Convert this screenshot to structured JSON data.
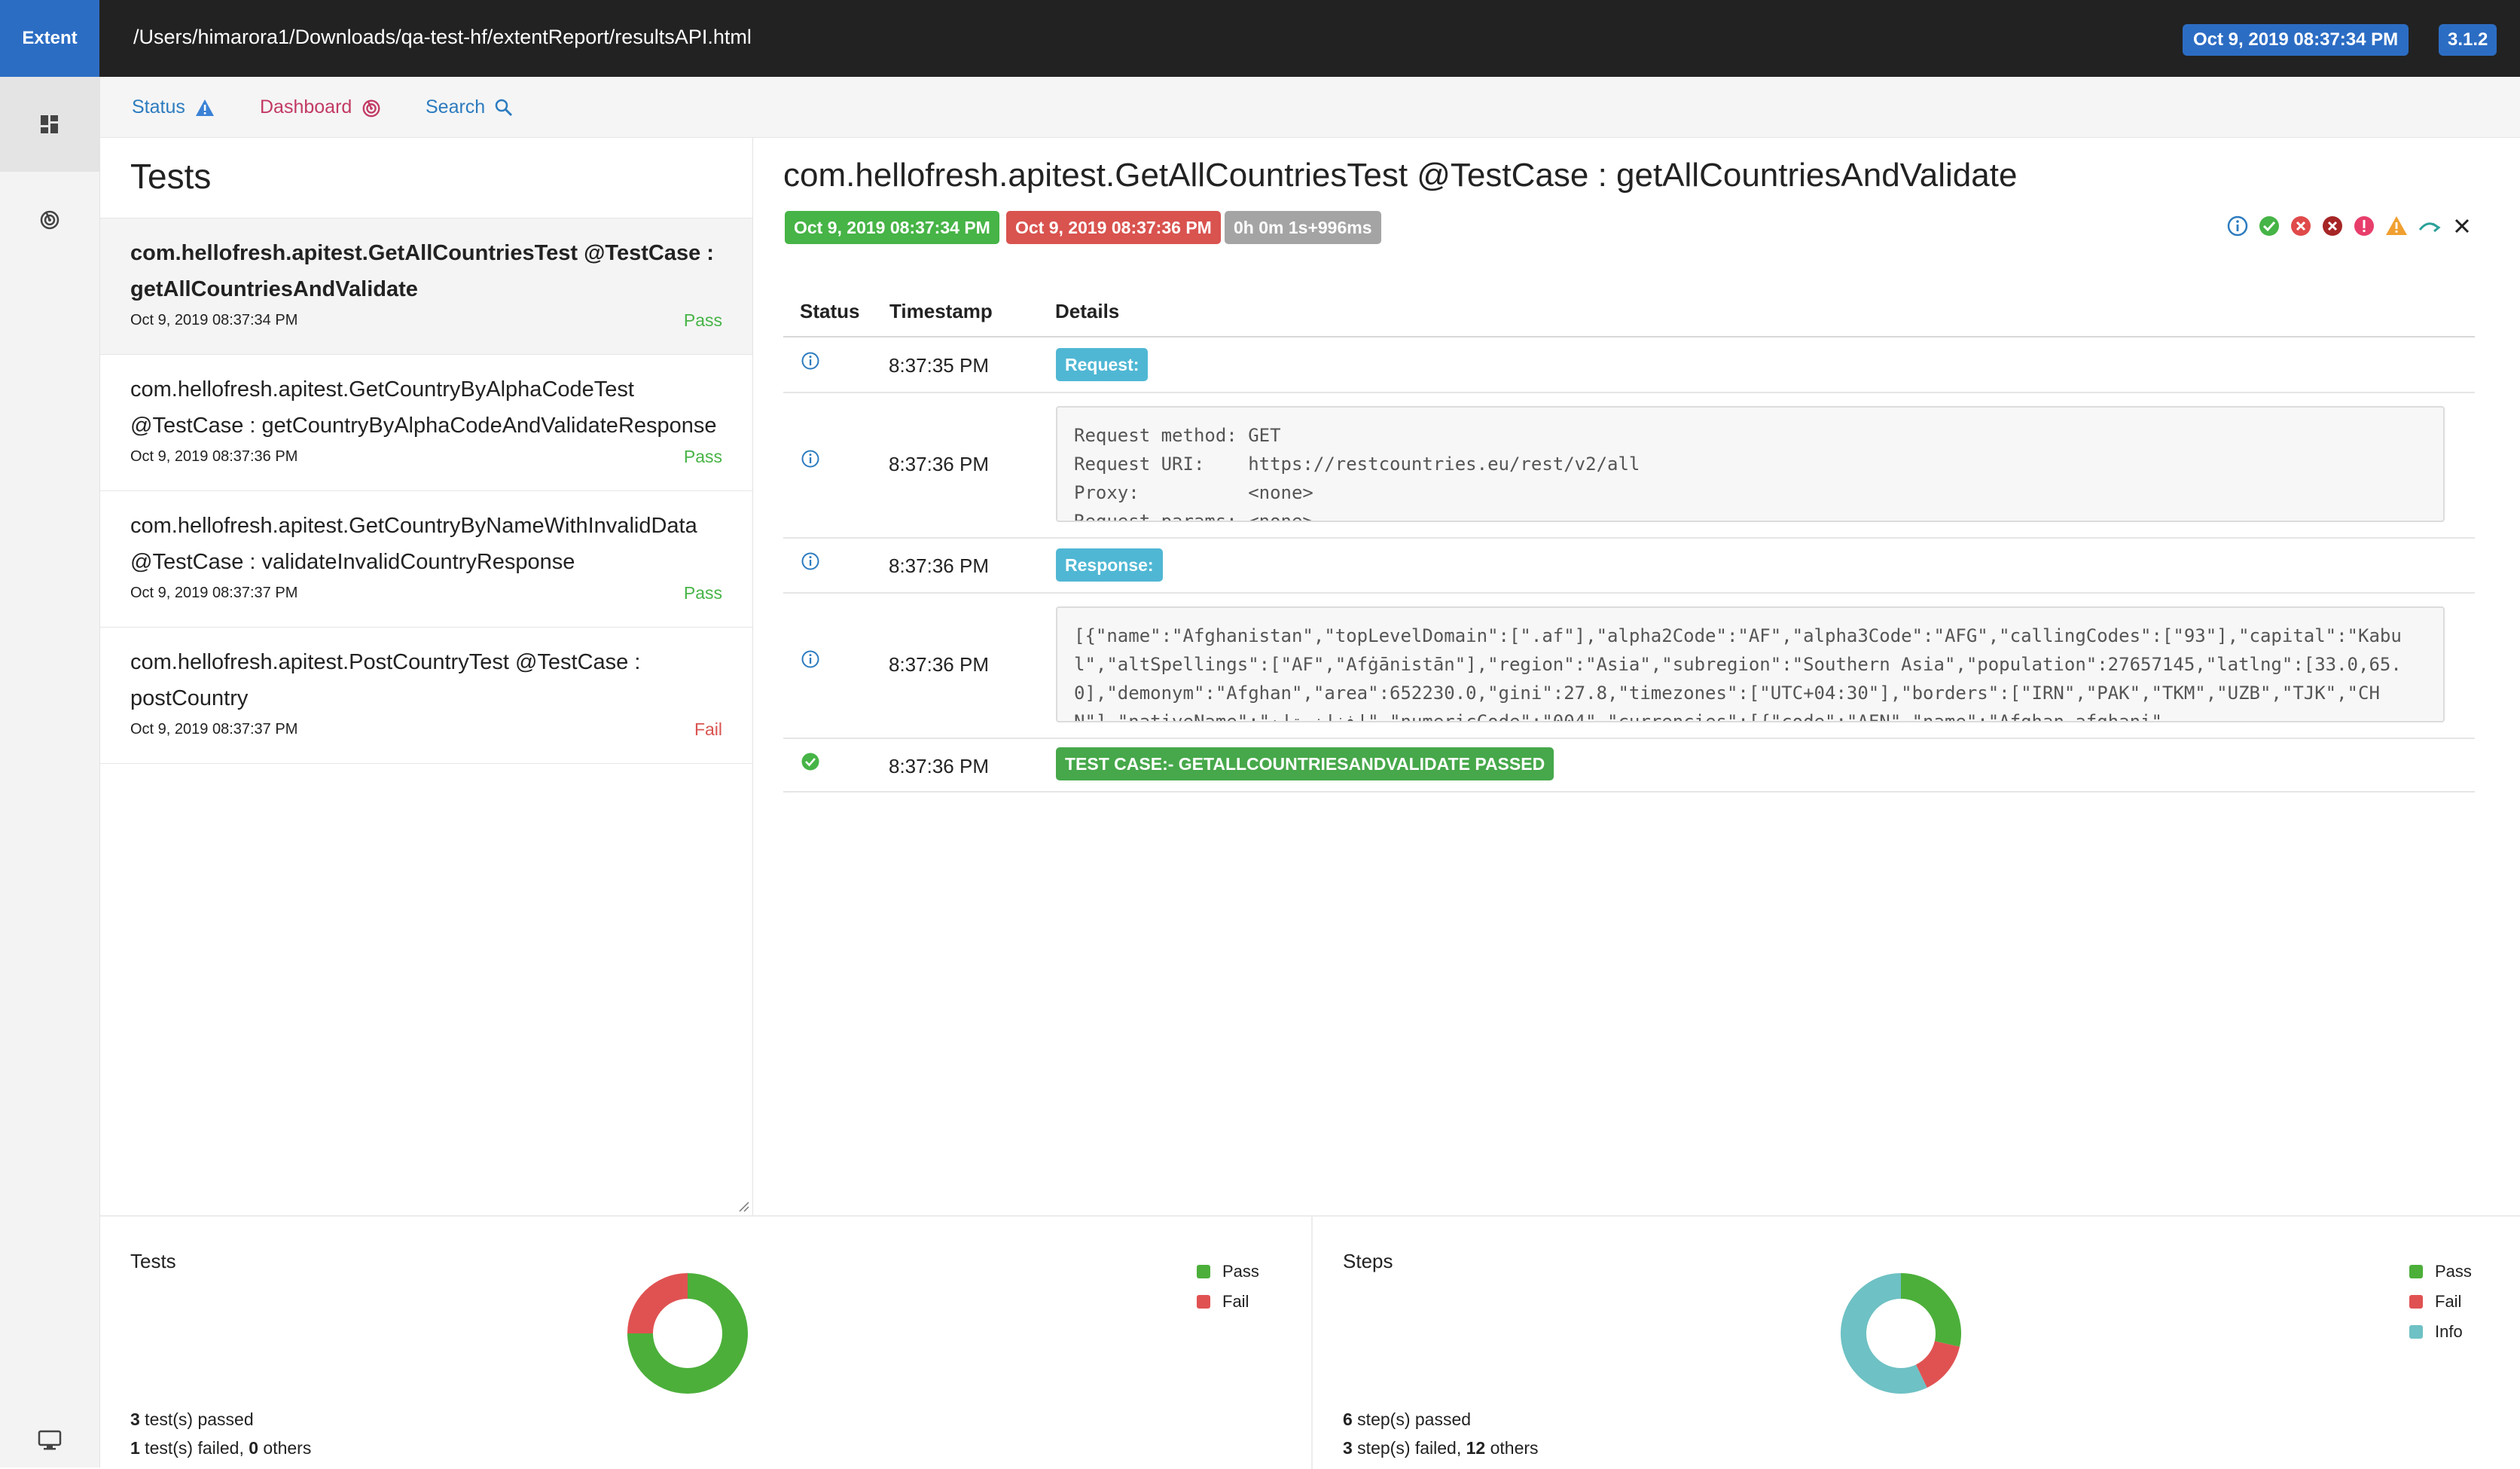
{
  "app": {
    "brand": "Extent",
    "file_path": "/Users/himarora1/Downloads/qa-test-hf/extentReport/resultsAPI.html",
    "report_time": "Oct 9, 2019 08:37:34 PM",
    "version": "3.1.2"
  },
  "sidebar": {
    "items": [
      {
        "icon": "dashboard-grid-icon"
      },
      {
        "icon": "dashboard-radar-icon"
      },
      {
        "icon": "monitor-icon"
      }
    ]
  },
  "subnav": {
    "status_label": "Status",
    "dashboard_label": "Dashboard",
    "search_label": "Search"
  },
  "tests_panel": {
    "title": "Tests",
    "items": [
      {
        "name": "com.hellofresh.apitest.GetAllCountriesTest @TestCase : getAllCountriesAndValidate",
        "time": "Oct 9, 2019 08:37:34 PM",
        "status": "Pass"
      },
      {
        "name": "com.hellofresh.apitest.GetCountryByAlphaCodeTest @TestCase : getCountryByAlphaCodeAndValidateResponse",
        "time": "Oct 9, 2019 08:37:36 PM",
        "status": "Pass"
      },
      {
        "name": "com.hellofresh.apitest.GetCountryByNameWithInvalidData @TestCase : validateInvalidCountryResponse",
        "time": "Oct 9, 2019 08:37:37 PM",
        "status": "Pass"
      },
      {
        "name": "com.hellofresh.apitest.PostCountryTest @TestCase : postCountry",
        "time": "Oct 9, 2019 08:37:37 PM",
        "status": "Fail"
      }
    ]
  },
  "detail": {
    "title": "com.hellofresh.apitest.GetAllCountriesTest @TestCase : getAllCountriesAndValidate",
    "start_time": "Oct 9, 2019 08:37:34 PM",
    "end_time": "Oct 9, 2019 08:37:36 PM",
    "duration": "0h 0m 1s+996ms",
    "columns": {
      "status": "Status",
      "timestamp": "Timestamp",
      "details": "Details"
    },
    "logs": [
      {
        "status_icon": "info-icon",
        "time": "8:37:35 PM",
        "label": "Request:"
      },
      {
        "status_icon": "info-icon",
        "time": "8:37:36 PM",
        "code": "Request method:\tGET\nRequest URI:\thttps://restcountries.eu/rest/v2/all\nProxy:\t\t\t<none>\nRequest params:\t<none>"
      },
      {
        "status_icon": "info-icon",
        "time": "8:37:36 PM",
        "label": "Response:"
      },
      {
        "status_icon": "info-icon",
        "time": "8:37:36 PM",
        "code": "[{\"name\":\"Afghanistan\",\"topLevelDomain\":[\".af\"],\"alpha2Code\":\"AF\",\"alpha3Code\":\"AFG\",\"callingCodes\":[\"93\"],\"capital\":\"Kabul\",\"altSpellings\":[\"AF\",\"Afġānistān\"],\"region\":\"Asia\",\"subregion\":\"Southern Asia\",\"population\":27657145,\"latlng\":[33.0,65.0],\"demonym\":\"Afghan\",\"area\":652230.0,\"gini\":27.8,\"timezones\":[\"UTC+04:30\"],\"borders\":[\"IRN\",\"PAK\",\"TKM\",\"UZB\",\"TJK\",\"CHN\"],\"nativeName\":\"افغانستان\",\"numericCode\":\"004\",\"currencies\":[{\"code\":\"AFN\",\"name\":\"Afghan afghani\""
      },
      {
        "status_icon": "check-circle-icon",
        "time": "8:37:36 PM",
        "label": "TEST CASE:- GETALLCOUNTRIESANDVALIDATE PASSED"
      }
    ]
  },
  "charts": {
    "tests": {
      "title": "Tests",
      "legend": [
        "Pass",
        "Fail"
      ],
      "summary": {
        "passed_count": "3",
        "passed_text": " test(s) passed",
        "failed_count": "1",
        "failed_text": " test(s) failed, ",
        "others_count": "0",
        "others_text": " others"
      }
    },
    "steps": {
      "title": "Steps",
      "legend": [
        "Pass",
        "Fail",
        "Info"
      ],
      "summary": {
        "passed_count": "6",
        "passed_text": " step(s) passed",
        "failed_count": "3",
        "failed_text": " step(s) failed, ",
        "others_count": "12",
        "others_text": " others"
      }
    }
  },
  "chart_data": [
    {
      "type": "pie",
      "title": "Tests",
      "categories": [
        "Pass",
        "Fail"
      ],
      "values": [
        3,
        1
      ],
      "colors": [
        "#4caf3a",
        "#e05252"
      ]
    },
    {
      "type": "pie",
      "title": "Steps",
      "categories": [
        "Pass",
        "Fail",
        "Info"
      ],
      "values": [
        6,
        3,
        12
      ],
      "colors": [
        "#4caf3a",
        "#e05252",
        "#6ec1c4"
      ]
    }
  ],
  "colors": {
    "pass": "#46b446",
    "fail": "#d9534f",
    "info": "#5bc0de",
    "accent": "#2c6dc4",
    "dashboard": "#c23a63",
    "duration": "#a4a4a4"
  }
}
